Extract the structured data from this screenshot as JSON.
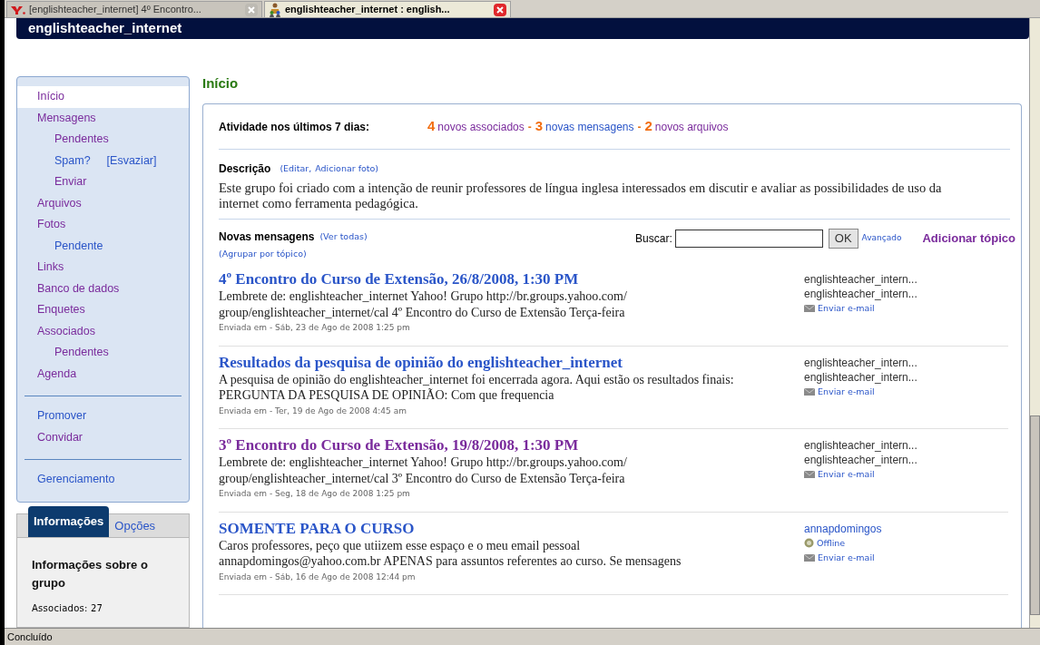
{
  "browser_tabs": [
    {
      "label": "[englishteacher_internet] 4º Encontro...",
      "selected": false,
      "kind": "yahoo"
    },
    {
      "label": "englishteacher_internet : english...",
      "selected": true,
      "kind": "group"
    }
  ],
  "header": {
    "title": "englishteacher_internet"
  },
  "sidebar": {
    "groups": [
      {
        "items": [
          {
            "label": "Início",
            "selected": true,
            "visited": true
          },
          {
            "label": "Mensagens",
            "selected": false,
            "visited": true,
            "children": [
              {
                "label": "Pendentes",
                "selected": false,
                "visited": true
              },
              {
                "label": "Spam?",
                "selected": false,
                "visited": false,
                "extra": "[Esvaziar]"
              },
              {
                "label": "Enviar",
                "selected": false,
                "visited": true
              }
            ]
          },
          {
            "label": "Arquivos",
            "selected": false,
            "visited": true
          },
          {
            "label": "Fotos",
            "selected": false,
            "visited": true,
            "children": [
              {
                "label": "Pendente",
                "selected": false,
                "visited": false
              }
            ]
          },
          {
            "label": "Links",
            "selected": false,
            "visited": true
          },
          {
            "label": "Banco de dados",
            "selected": false,
            "visited": true
          },
          {
            "label": "Enquetes",
            "selected": false,
            "visited": true
          },
          {
            "label": "Associados",
            "selected": false,
            "visited": true,
            "children": [
              {
                "label": "Pendentes",
                "selected": false,
                "visited": true
              }
            ]
          },
          {
            "label": "Agenda",
            "selected": false,
            "visited": true
          }
        ]
      },
      {
        "items": [
          {
            "label": "Promover",
            "selected": false,
            "visited": false
          },
          {
            "label": "Convidar",
            "selected": false,
            "visited": true
          }
        ]
      },
      {
        "items": [
          {
            "label": "Gerenciamento",
            "selected": false,
            "visited": false
          }
        ]
      }
    ]
  },
  "info_panel": {
    "tabs": [
      {
        "label": "Informações",
        "selected": true
      },
      {
        "label": "Opções",
        "selected": false
      }
    ],
    "title": "Informações sobre o grupo",
    "members": "Associados: 27"
  },
  "page_title": "Início",
  "activity": {
    "label": "Atividade nos últimos 7 dias:",
    "separator": "-",
    "items": [
      {
        "count": "4",
        "label": "novos associados",
        "visited": true
      },
      {
        "count": "3",
        "label": "novas mensagens",
        "visited": false
      },
      {
        "count": "2",
        "label": "novos arquivos",
        "visited": true
      }
    ]
  },
  "description": {
    "label": "Descrição",
    "links": [
      "(Editar,",
      "Adicionar foto)"
    ],
    "text": "Este grupo foi criado com a intenção de reunir professores de língua inglesa interessados em discutir e avaliar as possibilidades de uso da internet como ferramenta pedagógica."
  },
  "messages_section": {
    "label": "Novas mensagens",
    "view_all": "(Ver todas)",
    "group_by": "(Agrupar por tópico)",
    "search_label": "Buscar:",
    "search_button": "OK",
    "advanced": "Avançado",
    "add_topic": "Adicionar tópico"
  },
  "messages": [
    {
      "title": "4º Encontro do Curso de Extensão, 26/8/2008, 1:30 PM",
      "visited": false,
      "body": "Lembrete de: englishteacher_internet Yahoo! Grupo http://br.groups.yahoo.com/ group/englishteacher_internet/cal 4º Encontro do Curso de Extensão Terça-feira",
      "date": "Enviada em - Sáb, 23 de Ago de 2008 1:25 pm",
      "author_lines": [
        "englishteacher_intern...",
        "englishteacher_intern..."
      ],
      "author_link": false,
      "email": "Enviar e-mail"
    },
    {
      "title": "Resultados da pesquisa de opinião do englishteacher_internet",
      "visited": false,
      "body": "A pesquisa de opinião do englishteacher_internet foi encerrada agora. Aqui estão os resultados finais: PERGUNTA DA PESQUISA DE OPINIÃO: Com que frequencia",
      "date": "Enviada em - Ter, 19 de Ago de 2008 4:45 am",
      "author_lines": [
        "englishteacher_intern...",
        "englishteacher_intern..."
      ],
      "author_link": false,
      "email": "Enviar e-mail"
    },
    {
      "title": "3º Encontro do Curso de Extensão, 19/8/2008, 1:30 PM",
      "visited": true,
      "body": "Lembrete de: englishteacher_internet Yahoo! Grupo http://br.groups.yahoo.com/ group/englishteacher_internet/cal 3º Encontro do Curso de Extensão Terça-feira",
      "date": "Enviada em - Seg, 18 de Ago de 2008 1:25 pm",
      "author_lines": [
        "englishteacher_intern...",
        "englishteacher_intern..."
      ],
      "author_link": false,
      "email": "Enviar e-mail"
    },
    {
      "title": "SOMENTE PARA O CURSO",
      "visited": false,
      "body": "Caros professores, peço que utiizem esse espaço e o meu email pessoal annapdomingos@yahoo.com.br APENAS para assuntos referentes ao curso. Se mensagens",
      "date": "Enviada em - Sáb, 16 de Ago de 2008 12:44 pm",
      "author_lines": [
        "annapdomingos"
      ],
      "author_link": true,
      "presence": "Offline",
      "email": "Enviar e-mail"
    }
  ],
  "status_bar": "Concluído"
}
